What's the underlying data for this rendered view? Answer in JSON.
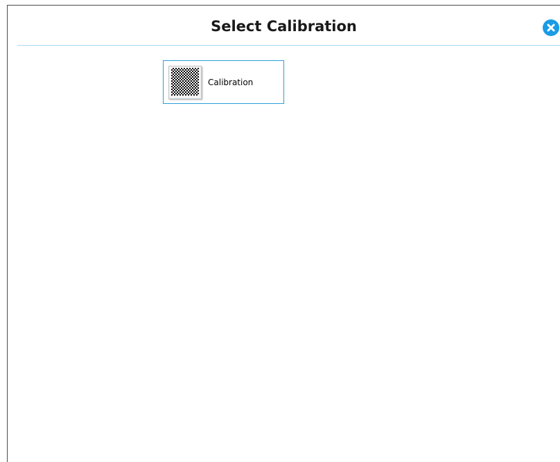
{
  "dialog": {
    "title": "Select Calibration",
    "close_icon": "close-icon",
    "accent_color": "#1a9be6"
  },
  "items": [
    {
      "label": "Calibration",
      "thumbnail_icon": "checkerboard-pattern-icon"
    }
  ]
}
